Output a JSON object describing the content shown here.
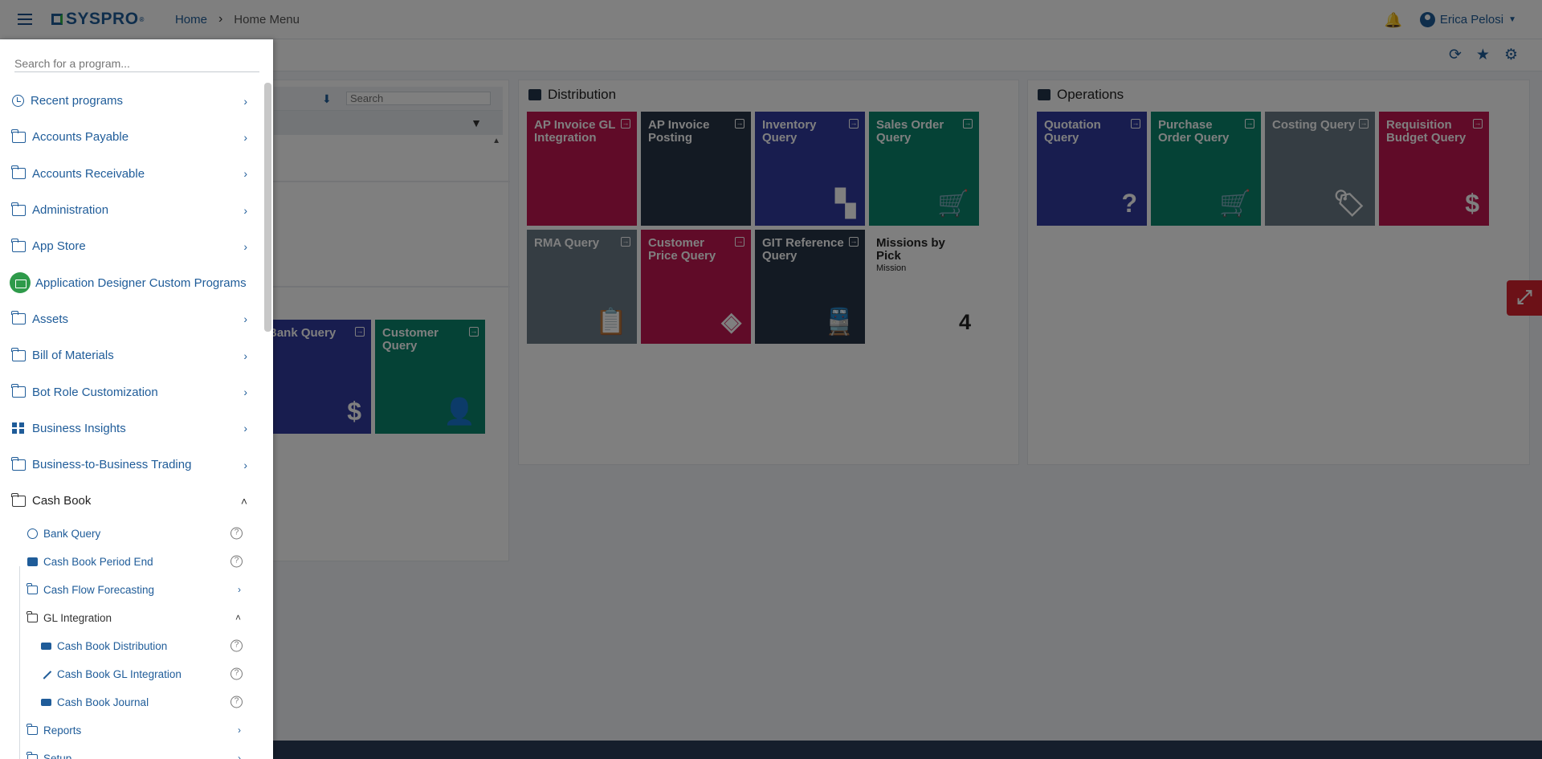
{
  "header": {
    "brand": "SYSPRO",
    "breadcrumb_home": "Home",
    "breadcrumb_current": "Home Menu",
    "user_name": "Erica Pelosi"
  },
  "workspace": {
    "left_card": {
      "search_placeholder": "Search",
      "tiles": [
        {
          "label": "Bank Query",
          "icon": "dollar-icon",
          "color": "#303a9e"
        },
        {
          "label": "Customer Query",
          "icon": "person-icon",
          "color": "#0b846c"
        }
      ]
    },
    "distribution": {
      "title": "Distribution",
      "tiles": [
        {
          "label": "AP Invoice GL Integration",
          "color": "#c01651"
        },
        {
          "label": "AP Invoice Posting",
          "color": "#263547"
        },
        {
          "label": "Inventory Query",
          "icon": "widgets-icon",
          "color": "#303a9e"
        },
        {
          "label": "Sales Order Query",
          "icon": "cart-icon",
          "color": "#0b846c"
        },
        {
          "label": "RMA Query",
          "icon": "clipboard-return-icon",
          "color": "#6a7a87"
        },
        {
          "label": "Customer Price Query",
          "icon": "price-tags-icon",
          "color": "#c01651"
        },
        {
          "label": "GIT Reference Query",
          "icon": "train-icon",
          "color": "#263547"
        }
      ],
      "missions": {
        "title": "Missions by Pick",
        "subtitle": "Mission",
        "value": "4"
      }
    },
    "operations": {
      "title": "Operations",
      "tiles": [
        {
          "label": "Quotation Query",
          "icon": "question-bubble-icon",
          "color": "#303a9e"
        },
        {
          "label": "Purchase Order Query",
          "icon": "cart-icon",
          "color": "#0b846c"
        },
        {
          "label": "Costing Query",
          "icon": "tag-icon",
          "color": "#6a7a87"
        },
        {
          "label": "Requisition Budget Query",
          "icon": "money-icon",
          "color": "#c01651"
        }
      ]
    }
  },
  "drawer": {
    "search_placeholder": "Search for a program...",
    "items": [
      {
        "label": "Recent programs",
        "icon": "clock-icon"
      },
      {
        "label": "Accounts Payable",
        "icon": "folder-icon"
      },
      {
        "label": "Accounts Receivable",
        "icon": "folder-icon"
      },
      {
        "label": "Administration",
        "icon": "folder-icon"
      },
      {
        "label": "App Store",
        "icon": "folder-icon"
      },
      {
        "label": "Application Designer Custom Programs",
        "icon": "folder-badge-icon"
      },
      {
        "label": "Assets",
        "icon": "folder-icon"
      },
      {
        "label": "Bill of Materials",
        "icon": "folder-icon"
      },
      {
        "label": "Bot Role Customization",
        "icon": "folder-icon"
      },
      {
        "label": "Business Insights",
        "icon": "dashboard-icon"
      },
      {
        "label": "Business-to-Business Trading",
        "icon": "folder-icon"
      },
      {
        "label": "Cash Book",
        "icon": "folder-open-icon"
      }
    ],
    "cash_book": {
      "children": [
        {
          "label": "Bank Query"
        },
        {
          "label": "Cash Book Period End"
        },
        {
          "label": "Cash Flow Forecasting"
        },
        {
          "label": "GL Integration"
        }
      ],
      "gl_integration": [
        {
          "label": "Cash Book Distribution"
        },
        {
          "label": "Cash Book GL Integration"
        },
        {
          "label": "Cash Book Journal"
        }
      ],
      "after": [
        {
          "label": "Reports"
        },
        {
          "label": "Setup"
        }
      ]
    }
  }
}
